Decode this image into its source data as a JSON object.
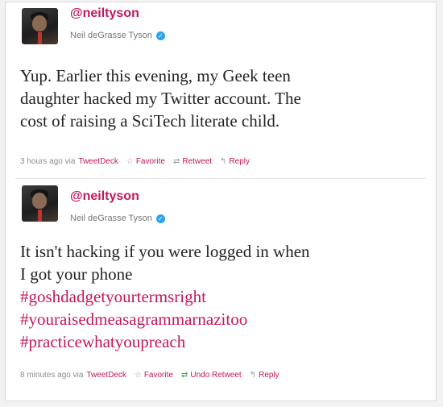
{
  "tweets": [
    {
      "handle": "@neiltyson",
      "name": "Neil deGrasse Tyson",
      "lines": [
        "Yup. Earlier this evening, my Geek teen",
        "daughter hacked my Twitter account. The",
        "cost of raising a SciTech literate child."
      ],
      "time": "3 hours ago via",
      "client": "TweetDeck",
      "favorite": "Favorite",
      "retweet": "Retweet",
      "reply": "Reply"
    },
    {
      "handle": "@neiltyson",
      "name": "Neil deGrasse Tyson",
      "lines": [
        "It isn't hacking if you were logged in when",
        "I got your phone"
      ],
      "hashtags": [
        "#goshdadgetyourtermsright",
        "#youraisedmeasagrammarnazitoo",
        "#practicewhatyoupreach"
      ],
      "time": "8 minutes ago via",
      "client": "TweetDeck",
      "favorite": "Favorite",
      "retweet": "Undo Retweet",
      "reply": "Reply"
    }
  ],
  "icons": {
    "verified": "verified-badge-icon",
    "favorite": "star-icon",
    "retweet": "retweet-icon",
    "reply": "reply-arrow-icon"
  },
  "colors": {
    "link": "#c2185b",
    "text": "#222222",
    "meta": "#8c8c8c",
    "verified": "#2aa3ef"
  }
}
